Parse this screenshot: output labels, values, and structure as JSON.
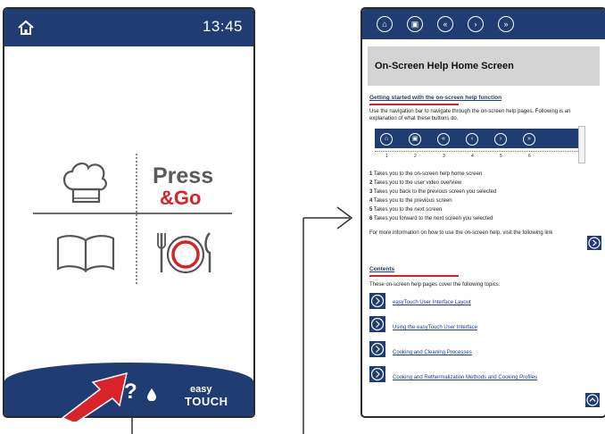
{
  "device": {
    "time": "13:45",
    "press_label": "Press",
    "go_label": "&Go",
    "help_label": "?",
    "logo_line1": "easy",
    "logo_line2": "TOUCH"
  },
  "help_screen": {
    "title": "On-Screen Help Home Screen",
    "section1": "Getting started with the on-screen help function",
    "intro": "Use the navigation bar to navigate through the on-screen help pages. Following is an explanation of what these buttons do.",
    "nav_numbers": [
      "1",
      "2",
      "3",
      "4",
      "5",
      "6"
    ],
    "items": [
      {
        "num": "1",
        "text": "Takes you to the on-screen help home screen"
      },
      {
        "num": "2",
        "text": "Takes you to the user video overview"
      },
      {
        "num": "3",
        "text": "Takes you back to the previous screen you selected"
      },
      {
        "num": "4",
        "text": "Takes you to the previous screen"
      },
      {
        "num": "5",
        "text": "Takes you to the next screen"
      },
      {
        "num": "6",
        "text": "Takes you forward to the next screen you selected"
      }
    ],
    "more_info": "For more information on how to use the on-screen help, visit the following link",
    "section2": "Contents",
    "topics_intro": "These on-screen help pages cover the following topics:",
    "topics": [
      "easyTouch User Interface Layout",
      "Using the easyTouch User Interface",
      "Cooking and Cleaning Processes",
      "Cooking and Rethermalization Methods and Cooking Profiles"
    ]
  },
  "colors": {
    "brand_blue": "#1f3d73",
    "accent_red": "#d8232a"
  }
}
